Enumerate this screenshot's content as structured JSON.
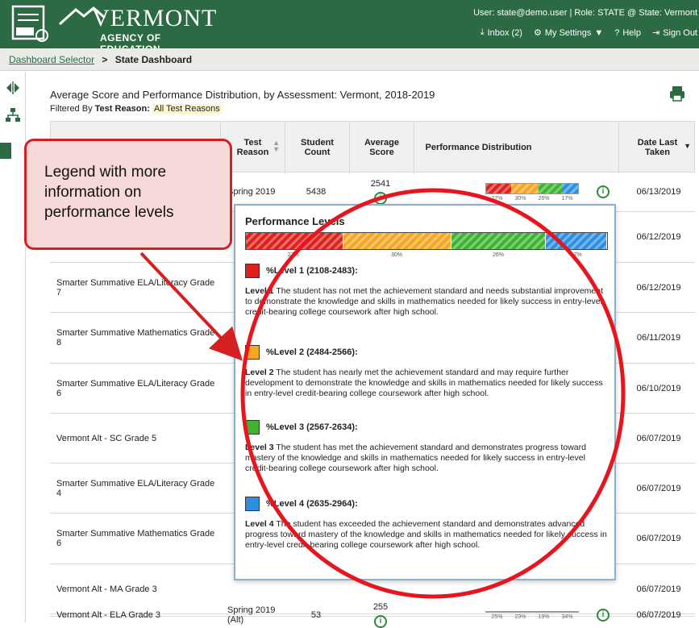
{
  "header": {
    "brand_name": "VERMONT",
    "brand_sub": "AGENCY OF EDUCATION",
    "user_line": "User: state@demo.user  |  Role: STATE @ State: Vermont",
    "inbox": "Inbox (2)",
    "settings": "My Settings",
    "help": "Help",
    "signout": "Sign Out"
  },
  "breadcrumb": {
    "link": "Dashboard Selector",
    "separator": ">",
    "current": "State Dashboard"
  },
  "page": {
    "title": "Average Score and Performance Distribution, by Assessment: Vermont, 2018-2019",
    "filter_prefix": "Filtered By",
    "filter_key": "Test Reason:",
    "filter_value": "All Test Reasons"
  },
  "table": {
    "headers": {
      "reason": "Test Reason",
      "count": "Student Count",
      "avg": "Average Score",
      "dist": "Performance Distribution",
      "date": "Date Last Taken"
    },
    "rows": [
      {
        "name": "",
        "reason": "Spring 2019",
        "count": "5438",
        "avg": "2541",
        "date": "06/13/2019",
        "dist": [
          27,
          30,
          26,
          17
        ],
        "dist_labels": [
          "27%",
          "30%",
          "26%",
          "17%"
        ]
      },
      {
        "name": "",
        "date": "06/12/2019"
      },
      {
        "name": "Smarter Summative ELA/Literacy Grade 7",
        "date": "06/12/2019"
      },
      {
        "name": "Smarter Summative Mathematics Grade 8",
        "date": "06/11/2019"
      },
      {
        "name": "Smarter Summative ELA/Literacy Grade 6",
        "date": "06/10/2019"
      },
      {
        "name": "Vermont Alt - SC Grade 5",
        "date": "06/07/2019"
      },
      {
        "name": "Smarter Summative ELA/Literacy Grade 4",
        "date": "06/07/2019"
      },
      {
        "name": "Smarter Summative Mathematics Grade 6",
        "date": "06/07/2019"
      },
      {
        "name": "Vermont Alt - MA Grade 3",
        "date": "06/07/2019"
      },
      {
        "name": "Vermont Alt - ELA Grade 3",
        "reason": "Spring 2019 (Alt)",
        "count": "53",
        "avg": "255",
        "date": "06/07/2019",
        "dist": [
          25,
          23,
          19,
          34
        ],
        "dist_labels": [
          "25%",
          "23%",
          "19%",
          "34%"
        ]
      }
    ]
  },
  "popup": {
    "title": "Performance Levels",
    "distribution": [
      27,
      30,
      26,
      17
    ],
    "distribution_labels": [
      "27%",
      "30%",
      "26%",
      "17%"
    ],
    "levels": [
      {
        "label": "%Level 1 (2108-2483):",
        "color": "#e0211b",
        "desc_bold": "Level 1",
        "desc": " The student has not met the achievement standard and needs substantial improvement to demonstrate the knowledge and skills in mathematics needed for likely success in entry-level credit-bearing college coursework after high school."
      },
      {
        "label": "%Level 2 (2484-2566):",
        "color": "#f5a623",
        "desc_bold": "Level 2",
        "desc": " The student has nearly met the achievement standard and may require further development to demonstrate the knowledge and skills in mathematics needed for likely success in entry-level credit-bearing college coursework after high school."
      },
      {
        "label": "%Level 3 (2567-2634):",
        "color": "#3cb432",
        "desc_bold": "Level 3",
        "desc": " The student has met the achievement standard and demonstrates progress toward mastery of the knowledge and skills in mathematics needed for likely success in entry-level credit-bearing college coursework after high school."
      },
      {
        "label": "%Level 4 (2635-2964):",
        "color": "#2e8fe0",
        "desc_bold": "Level 4",
        "desc": " The student has exceeded the achievement standard and demonstrates advanced progress toward mastery of the knowledge and skills in mathematics needed for likely success in entry-level credit-bearing college coursework after high school."
      }
    ]
  },
  "callout": {
    "text": "Legend with more information on performance levels"
  },
  "colors": {
    "brand": "#2c6a43",
    "accent_red": "#d42020",
    "popup_border": "#8ab2cf"
  }
}
